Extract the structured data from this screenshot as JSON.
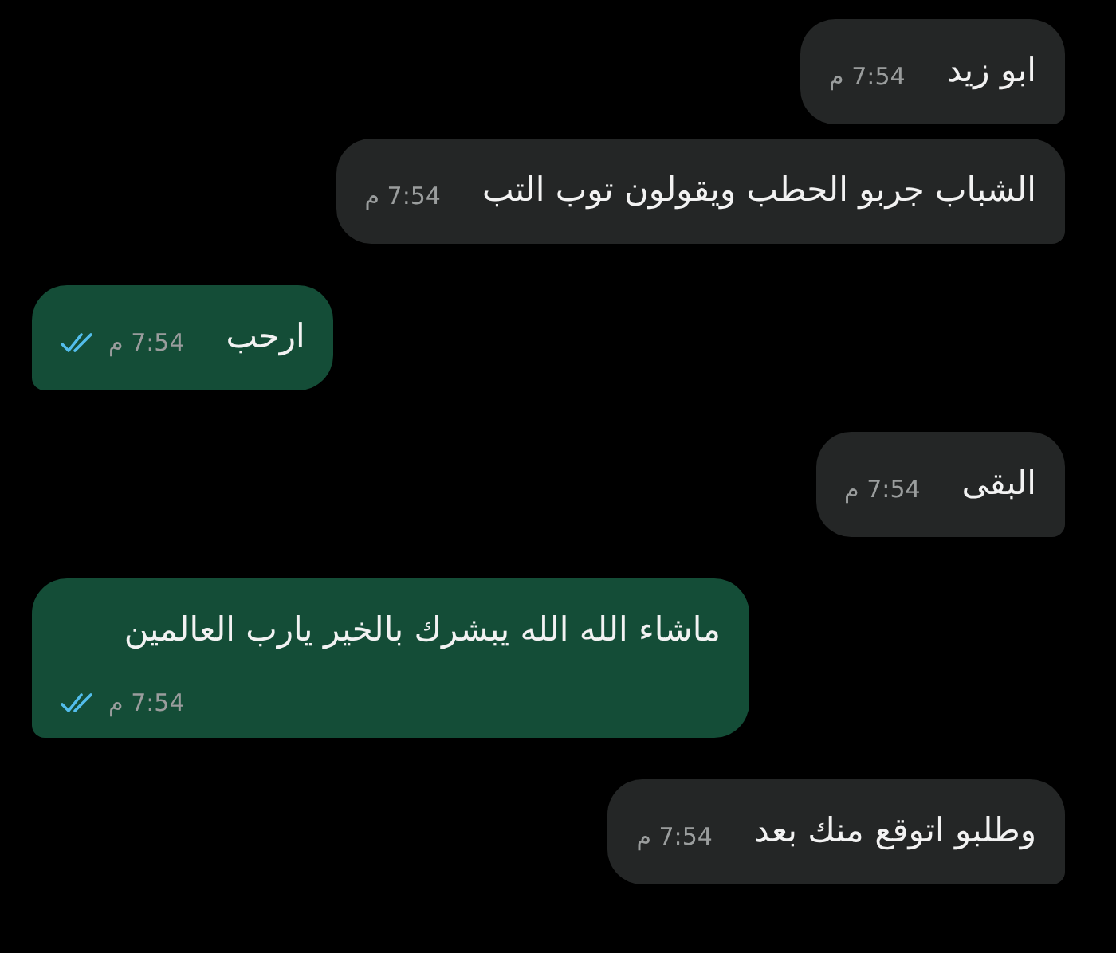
{
  "messages": [
    {
      "kind": "incoming",
      "text": "ابو زيد",
      "time": "7:54 م"
    },
    {
      "kind": "incoming",
      "text": "الشباب جربو الحطب ويقولون توب التب",
      "time": "7:54 م"
    },
    {
      "kind": "outgoing",
      "text": "ارحب",
      "time": "7:54 م",
      "read": true
    },
    {
      "kind": "incoming",
      "text": "البقى",
      "time": "7:54 م"
    },
    {
      "kind": "outgoing",
      "text": "ماشاء الله الله يبشرك بالخير يارب العالمين",
      "time": "7:54 م",
      "read": true
    },
    {
      "kind": "incoming",
      "text": "وطلبو اتوقع منك بعد",
      "time": "7:54 م"
    }
  ]
}
